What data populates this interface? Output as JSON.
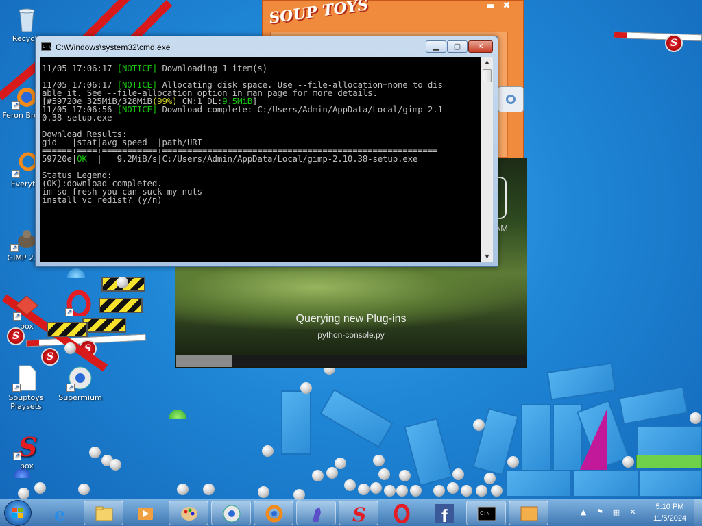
{
  "desktop": {
    "icons": [
      {
        "label": "Recycle"
      },
      {
        "label": "Feron Brows"
      },
      {
        "label": "Everyth"
      },
      {
        "label": "GIMP 2.1"
      },
      {
        "label": "box"
      },
      {
        "label": "Souptoys Playsets"
      },
      {
        "label": "Supermium"
      },
      {
        "label": "box"
      }
    ]
  },
  "souptoys": {
    "logo": "SOUP TOYS",
    "min_label": "▬",
    "close_label": "✖"
  },
  "gimp_splash": {
    "status": "Querying new Plug-ins",
    "detail": "python-console.py",
    "progress": 0.16,
    "partial_text": "AM"
  },
  "cmd": {
    "title": "C:\\Windows\\system32\\cmd.exe",
    "icon_text": "C:\\",
    "minimize_label": "▁",
    "maximize_label": "▢",
    "close_label": "✕",
    "lines": {
      "l1_time": "11/05 17:06:17 ",
      "l1_tag": "[NOTICE]",
      "l1_msg": " Downloading 1 item(s)",
      "l2_time": "11/05 17:06:17 ",
      "l2_tag": "[NOTICE]",
      "l2_msg": " Allocating disk space. Use --file-allocation=none to dis",
      "l3": "able it. See --file-allocation option in man page for more details.",
      "l4_a": "[#59720e 325MiB/328MiB",
      "l4_b": "(99%)",
      "l4_c": " CN:1 DL:",
      "l4_d": "9.5MiB",
      "l4_e": "]",
      "l5_time": "11/05 17:06:56 ",
      "l5_tag": "[NOTICE]",
      "l5_msg": " Download complete: C:/Users/Admin/AppData/Local/gimp-2.1",
      "l6": "0.38-setup.exe",
      "l7": "Download Results:",
      "l8": "gid   |stat|avg speed  |path/URI",
      "l9": "======+====+===========+=======================================================",
      "l10_a": "59720e|",
      "l10_b": "OK",
      "l10_c": "  |   9.2MiB/s|C:/Users/Admin/AppData/Local/gimp-2.10.38-setup.exe",
      "l11": "Status Legend:",
      "l12": "(OK):download completed.",
      "l13": "im so fresh you can suck my nuts",
      "l14": "install vc redist? (y/n)"
    }
  },
  "taskbar": {
    "apps": [
      {
        "name": "internet-explorer"
      },
      {
        "name": "file-explorer"
      },
      {
        "name": "media-player"
      },
      {
        "name": "gimp-paint"
      },
      {
        "name": "supermium"
      },
      {
        "name": "feronbrowser"
      },
      {
        "name": "gimp-wilber"
      },
      {
        "name": "souptoys"
      },
      {
        "name": "opera"
      },
      {
        "name": "facebook"
      },
      {
        "name": "cmd"
      },
      {
        "name": "souptoys-playsets"
      }
    ],
    "clock_time": "5:10 PM",
    "clock_date": "11/5/2024"
  }
}
